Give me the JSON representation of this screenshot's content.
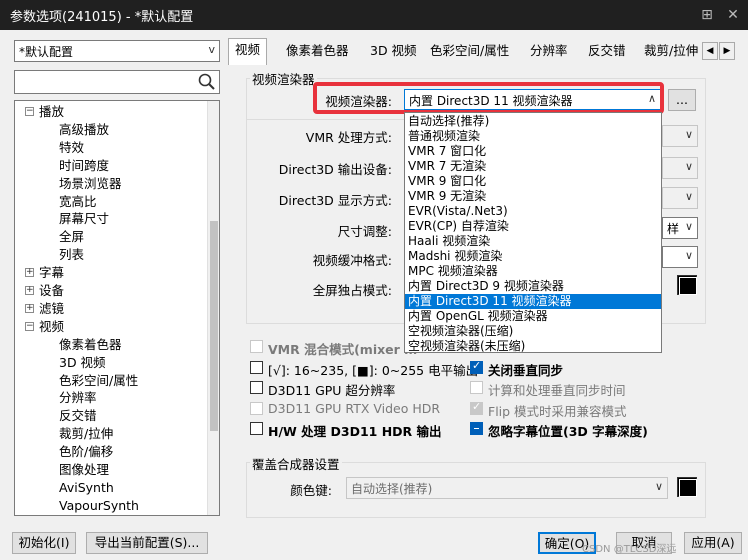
{
  "window": {
    "title": "参数选项(241015) - *默认配置",
    "pin": "⊞",
    "close": "✕"
  },
  "profile": {
    "value": "*默认配置"
  },
  "tree": {
    "items": [
      {
        "label": "播放",
        "level": 0,
        "exp": "−"
      },
      {
        "label": "高级播放",
        "level": 1
      },
      {
        "label": "特效",
        "level": 1
      },
      {
        "label": "时间跨度",
        "level": 1
      },
      {
        "label": "场景浏览器",
        "level": 1
      },
      {
        "label": "宽高比",
        "level": 1
      },
      {
        "label": "屏幕尺寸",
        "level": 1
      },
      {
        "label": "全屏",
        "level": 1
      },
      {
        "label": "列表",
        "level": 1
      },
      {
        "label": "字幕",
        "level": 0,
        "exp": "+"
      },
      {
        "label": "设备",
        "level": 0,
        "exp": "+"
      },
      {
        "label": "滤镜",
        "level": 0,
        "exp": "+"
      },
      {
        "label": "视频",
        "level": 0,
        "exp": "−"
      },
      {
        "label": "像素着色器",
        "level": 1
      },
      {
        "label": "3D 视频",
        "level": 1
      },
      {
        "label": "色彩空间/属性",
        "level": 1
      },
      {
        "label": "分辨率",
        "level": 1
      },
      {
        "label": "反交错",
        "level": 1
      },
      {
        "label": "裁剪/拉伸",
        "level": 1
      },
      {
        "label": "色阶/偏移",
        "level": 1
      },
      {
        "label": "图像处理",
        "level": 1
      },
      {
        "label": "AviSynth",
        "level": 1
      },
      {
        "label": "VapourSynth",
        "level": 1
      }
    ]
  },
  "tabs": [
    "视频",
    "像素着色器",
    "3D 视频",
    "色彩空间/属性",
    "分辨率",
    "反交错",
    "裁剪/拉伸"
  ],
  "main": {
    "group_title": "视频渲染器",
    "renderer_label": "视频渲染器:",
    "renderer_value": "内置 Direct3D 11 视频渲染器",
    "more_button": "...",
    "vmr_label": "VMR 处理方式:",
    "d3d_out_label": "Direct3D 输出设备:",
    "d3d_disp_label": "Direct3D 显示方式:",
    "resize_label": "尺寸调整:",
    "resize_value_tail": "样",
    "buffer_label": "视频缓冲格式:",
    "fse_label": "全屏独占模式:",
    "vmr_mix": "VMR 混合模式(mixer m",
    "range_text": "[√]: 16~235, [■]: 0~255 电平输出",
    "vsync": "关闭垂直同步",
    "gpu_sr": "D3D11 GPU 超分辨率",
    "vsync_calc": "计算和处理垂直同步时间",
    "rtx_hdr": "D3D11 GPU RTX Video HDR",
    "flip": "Flip 模式时采用兼容模式",
    "hdr_out": "H/W 处理 D3D11 HDR 输出",
    "sub_pos": "忽略字幕位置(3D 字幕深度)"
  },
  "overlay": {
    "title": "覆盖合成器设置",
    "color_label": "颜色键:",
    "color_value": "自动选择(推荐)"
  },
  "dropdown": {
    "options": [
      "自动选择(推荐)",
      "普通视频渲染",
      "VMR 7 窗口化",
      "VMR 7 无渲染",
      "VMR 9 窗口化",
      "VMR 9 无渲染",
      "EVR(Vista/.Net3)",
      "EVR(CP) 自荐渲染",
      "Haali 视频渲染",
      "Madshi 视频渲染",
      "MPC 视频渲染器",
      "内置 Direct3D 9 视频渲染器",
      "内置 Direct3D 11 视频渲染器",
      "内置 OpenGL 视频渲染器",
      "空视频渲染器(压缩)",
      "空视频渲染器(未压缩)"
    ],
    "selected_index": 12
  },
  "buttons": {
    "init": "初始化(I)",
    "export": "导出当前配置(S)...",
    "ok": "确定(O)",
    "cancel": "取消",
    "apply": "应用(A)"
  },
  "watermark": "CSDN @TLCSD深远"
}
